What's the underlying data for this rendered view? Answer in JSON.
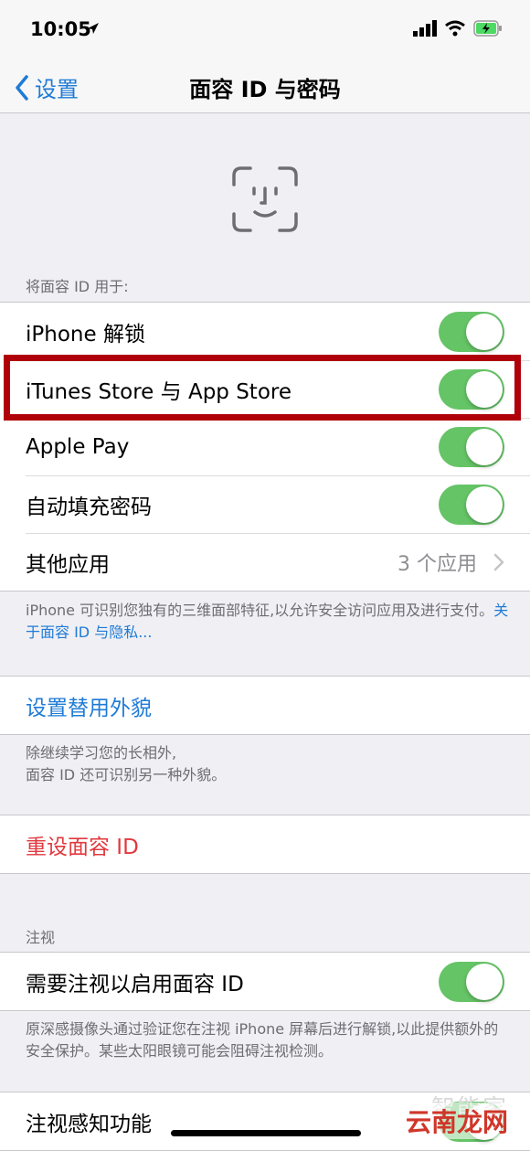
{
  "status_bar": {
    "time": "10:05"
  },
  "nav": {
    "back_label": "设置",
    "title": "面容 ID 与密码"
  },
  "use_for": {
    "header": "将面容 ID 用于:",
    "items": [
      {
        "label": "iPhone 解锁",
        "on": true
      },
      {
        "label": "iTunes Store 与 App Store",
        "on": true
      },
      {
        "label": "Apple Pay",
        "on": true
      },
      {
        "label": "自动填充密码",
        "on": true
      }
    ],
    "other_apps": {
      "label": "其他应用",
      "value": "3 个应用"
    },
    "footer_text": "iPhone 可识别您独有的三维面部特征,以允许安全访问应用及进行支付。",
    "footer_link": "关于面容 ID 与隐私..."
  },
  "alternate": {
    "label": "设置替用外貌",
    "footer_line1": "除继续学习您的长相外,",
    "footer_line2": "面容 ID 还可识别另一种外貌。"
  },
  "reset": {
    "label": "重设面容 ID"
  },
  "attention": {
    "header": "注视",
    "require_label": "需要注视以启用面容 ID",
    "require_on": true,
    "footer": "原深感摄像头通过验证您在注视 iPhone 屏幕后进行解锁,以此提供额外的安全保护。某些太阳眼镜可能会阻碍注视检测。",
    "aware_label": "注视感知功能"
  },
  "watermark": {
    "text1": "智能家",
    "text2": "云南龙网"
  },
  "colors": {
    "switch_on": "#65c466",
    "accent_blue": "#1f7bd6",
    "destructive_red": "#e0393e",
    "highlight_box": "#b0000a"
  }
}
